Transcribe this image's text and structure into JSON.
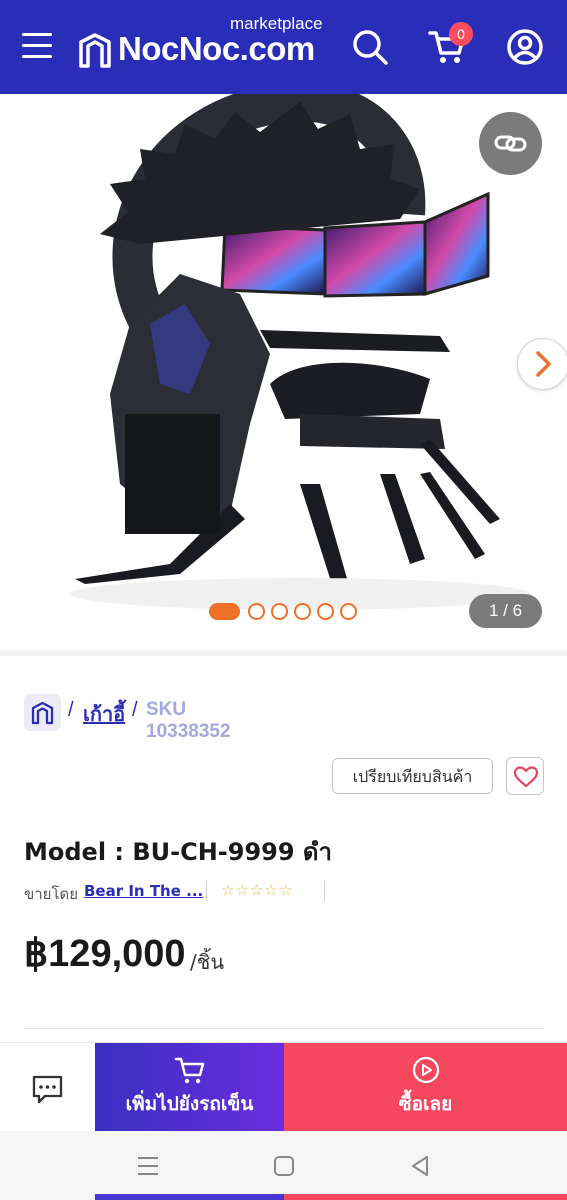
{
  "header": {
    "logo_subtitle": "marketplace",
    "logo_name": "NocNoc.com",
    "cart_count": "0"
  },
  "gallery": {
    "counter": "1 / 6",
    "total_images": 6,
    "active_index": 0
  },
  "breadcrumb": {
    "separator": "/",
    "category": "เก้าอี้",
    "sku": "SKU 10338352"
  },
  "actions": {
    "compare_label": "เปรียบเทียบสินค้า"
  },
  "product": {
    "title": "Model : BU-CH-9999 ดำ",
    "seller_label": "ขายโดย",
    "seller_name": "Bear In The ...",
    "price": "฿129,000",
    "unit": "/ชิ้น"
  },
  "bottom_bar": {
    "add_to_cart_label": "เพิ่มไปยังรถเข็น",
    "buy_now_label": "ซื้อเลย"
  },
  "colors": {
    "brand": "#2a2db8",
    "accent": "#f0702a",
    "buy": "#f5485f"
  }
}
